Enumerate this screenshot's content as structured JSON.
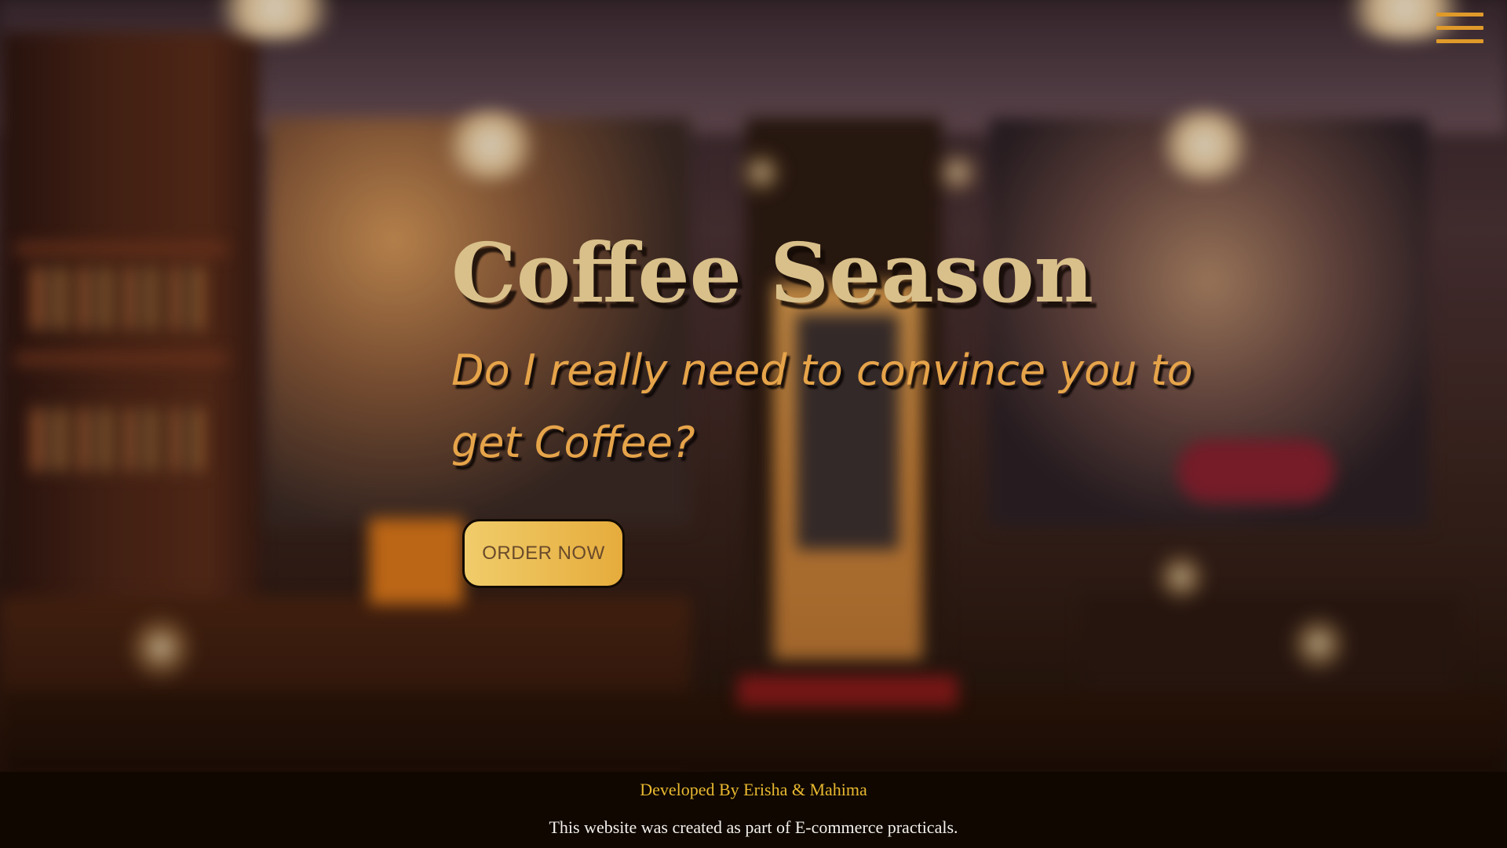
{
  "hero": {
    "title": "Coffee Season",
    "subtitle": "Do I really need to convince you to get Coffee?",
    "order_button_label": "ORDER NOW"
  },
  "nav": {
    "menu_icon": "hamburger-menu-icon"
  },
  "footer": {
    "credits": "Developed By Erisha & Mahima",
    "note": "This website was created as part of E-commerce practicals."
  },
  "colors": {
    "title": "#d9c08a",
    "subtitle": "#e6a44a",
    "button_bg": "#e6ac3c",
    "menu_icon": "#e09a2a",
    "footer_bg": "#0f0700",
    "footer_credits": "#e8b830",
    "footer_note": "#f4f0ea"
  }
}
